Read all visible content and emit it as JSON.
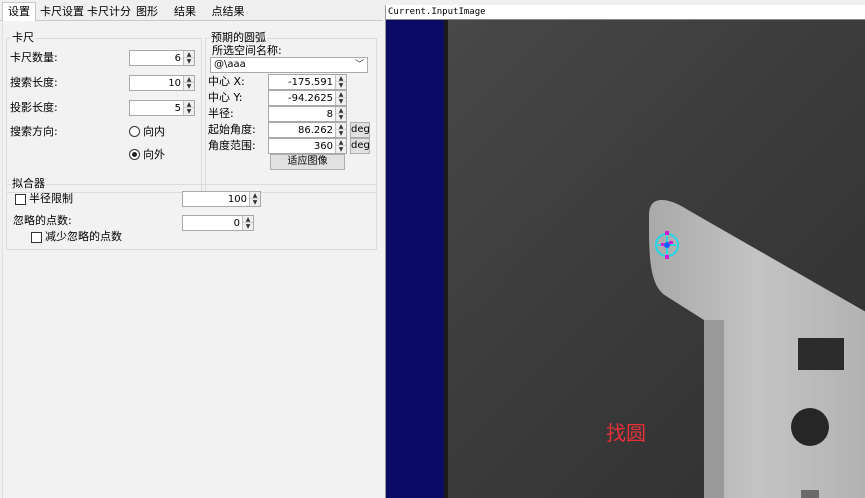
{
  "tabs": [
    "设置",
    "卡尺设置",
    "卡尺计分",
    "图形",
    "结果",
    "点结果"
  ],
  "caliper": {
    "legend": "卡尺",
    "count_label": "卡尺数量:",
    "count": "6",
    "search_length_label": "搜索长度:",
    "search_length": "10",
    "projection_length_label": "投影长度:",
    "projection_length": "5",
    "direction_label": "搜索方向:",
    "dir_inward": "向内",
    "dir_outward": "向外"
  },
  "expected_arc": {
    "legend": "预期的圆弧",
    "space_label": "所选空间名称:",
    "space_value": "@\\aaa",
    "center_x_label": "中心 X:",
    "center_x": "-175.591",
    "center_y_label": "中心 Y:",
    "center_y": "-94.2625",
    "radius_label": "半径:",
    "radius": "8",
    "start_angle_label": "起始角度:",
    "start_angle": "86.262",
    "angle_range_label": "角度范围:",
    "angle_range": "360",
    "deg_unit": "deg",
    "fit_button": "适应图像"
  },
  "fitter": {
    "legend": "拟合器",
    "radius_limit_label": "半径限制",
    "radius_limit": "100",
    "ignore_points_label": "忽略的点数:",
    "ignore_points": "0",
    "reduce_ignored_label": "减少忽略的点数"
  },
  "image_view": {
    "title": "Current.InputImage",
    "overlay_text": "找圆",
    "colors": {
      "left_band": "#0b0b66",
      "overlay_text": "#e8303a",
      "marker": "#1fd9e8"
    }
  }
}
